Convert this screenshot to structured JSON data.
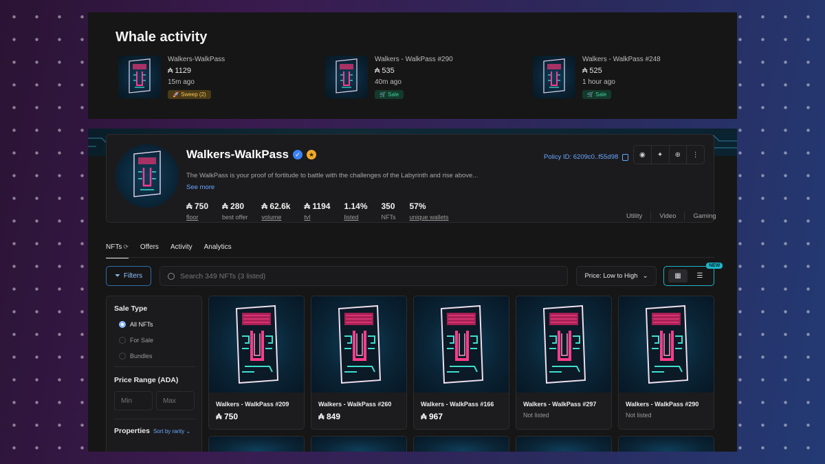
{
  "whale": {
    "title": "Whale activity",
    "items": [
      {
        "name": "Walkers-WalkPass",
        "price": "₳ 1129",
        "time": "15m ago",
        "badge": "🚀 Sweep (2)",
        "badge_type": "sweep"
      },
      {
        "name": "Walkers - WalkPass #290",
        "price": "₳ 535",
        "time": "40m ago",
        "badge": "🛒 Sale",
        "badge_type": "sale"
      },
      {
        "name": "Walkers - WalkPass #248",
        "price": "₳ 525",
        "time": "1 hour ago",
        "badge": "🛒 Sale",
        "badge_type": "sale"
      }
    ]
  },
  "collection": {
    "title": "Walkers-WalkPass",
    "description": "The WalkPass is your proof of fortitude to battle with the challenges of the Labyrinth and rise above...",
    "see_more": "See more",
    "policy": "Policy ID: 6209c0..f55d98",
    "stats": [
      {
        "value": "₳ 750",
        "label": "floor"
      },
      {
        "value": "₳ 280",
        "label": "best offer"
      },
      {
        "value": "₳ 62.6k",
        "label": "volume"
      },
      {
        "value": "₳ 1194",
        "label": "tvl"
      },
      {
        "value": "1.14%",
        "label": "listed"
      },
      {
        "value": "350",
        "label": "NFTs"
      },
      {
        "value": "57%",
        "label": "unique wallets"
      }
    ],
    "tags": [
      "Utility",
      "Video",
      "Gaming"
    ]
  },
  "tabs": [
    "NFTs",
    "Offers",
    "Activity",
    "Analytics"
  ],
  "toolbar": {
    "filters": "Filters",
    "search_placeholder": "Search 349 NFTs (3 listed)",
    "sort": "Price: Low to High",
    "new_badge": "NEW"
  },
  "sidebar": {
    "sale_type": "Sale Type",
    "options": [
      "All NFTs",
      "For Sale",
      "Bundles"
    ],
    "price_range": "Price Range (ADA)",
    "min": "Min",
    "max": "Max",
    "properties": "Properties",
    "sort_by_rarity": "Sort by rarity"
  },
  "cards": [
    {
      "name": "Walkers - WalkPass #209",
      "price": "₳ 750"
    },
    {
      "name": "Walkers - WalkPass #260",
      "price": "₳ 849"
    },
    {
      "name": "Walkers - WalkPass #166",
      "price": "₳ 967"
    },
    {
      "name": "Walkers - WalkPass #297",
      "status": "Not listed"
    },
    {
      "name": "Walkers - WalkPass #290",
      "status": "Not listed"
    }
  ],
  "colors": {
    "accent": "#1fb6c9",
    "link": "#6aa8ff",
    "sweep": "#f2c656",
    "sale": "#3fd19a"
  }
}
